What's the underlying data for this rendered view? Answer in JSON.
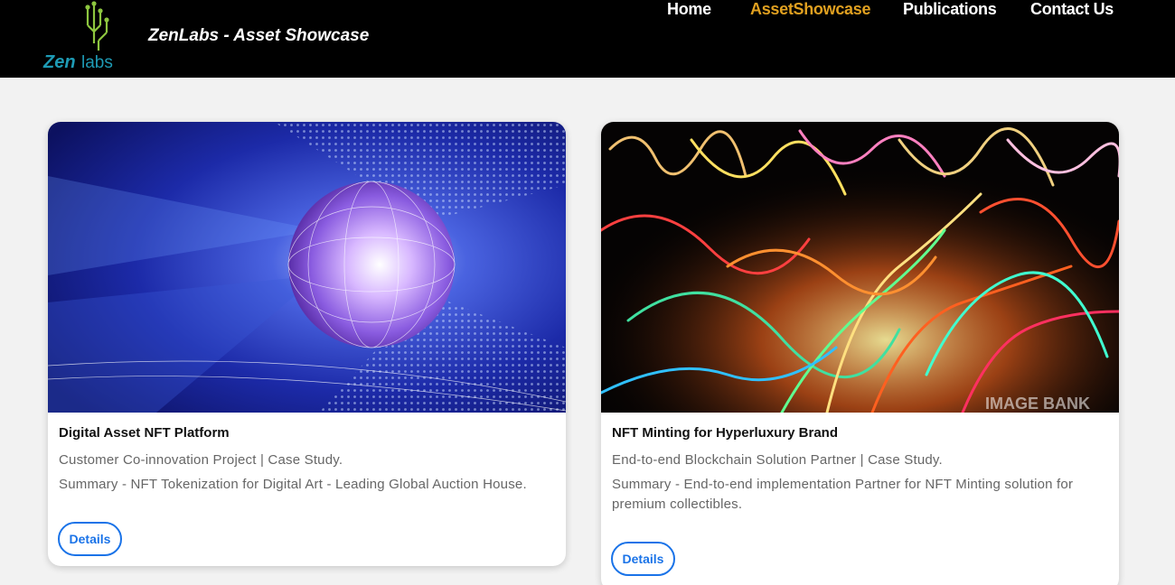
{
  "header": {
    "logo_text_1": "Zen",
    "logo_text_2": "labs",
    "brand_title": "ZenLabs - Asset Showcase",
    "nav": [
      {
        "label": "Home",
        "active": false
      },
      {
        "label": "AssetShowcase",
        "active": true
      },
      {
        "label": "Publications",
        "active": false
      },
      {
        "label": "Contact Us",
        "active": false
      }
    ],
    "active_color": "#e0a020"
  },
  "cards": [
    {
      "title": "Digital Asset NFT Platform",
      "subtitle": "Customer Co-innovation Project | Case Study.",
      "summary": "Summary - NFT Tokenization for Digital Art - Leading Global Auction House.",
      "button": "Details",
      "image": "digital-sphere-image"
    },
    {
      "title": "NFT Minting for Hyperluxury Brand",
      "subtitle": "End-to-end Blockchain Solution Partner | Case Study.",
      "summary": "Summary - End-to-end implementation Partner for NFT Minting solution for premium collectibles.",
      "button": "Details",
      "image": "light-trails-image",
      "watermark": "IMAGE BANK"
    }
  ],
  "colors": {
    "button_blue": "#1a73e8",
    "navbar": "#000000"
  }
}
